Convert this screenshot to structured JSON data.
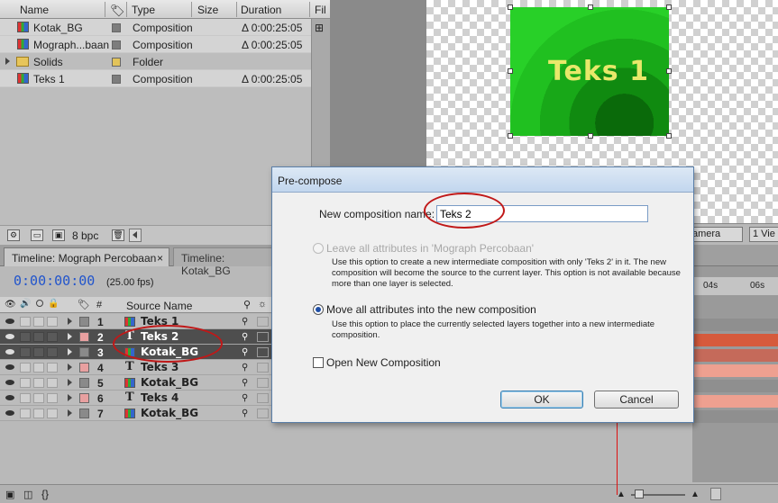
{
  "project": {
    "columns": {
      "name": "Name",
      "type": "Type",
      "size": "Size",
      "duration": "Duration",
      "fi": "Fil"
    },
    "items": [
      {
        "name": "Kotak_BG",
        "type": "Composition",
        "duration": "Δ 0:00:25:05",
        "icon": "composition-icon",
        "label_color": "#7d7d7d"
      },
      {
        "name": "Mograph...baan",
        "type": "Composition",
        "duration": "Δ 0:00:25:05",
        "icon": "composition-icon",
        "label_color": "#7d7d7d"
      },
      {
        "name": "Solids",
        "type": "Folder",
        "duration": "",
        "icon": "folder-icon",
        "label_color": "#e2c35a"
      },
      {
        "name": "Teks 1",
        "type": "Composition",
        "duration": "Δ 0:00:25:05",
        "icon": "composition-icon",
        "label_color": "#7d7d7d"
      }
    ],
    "bpc": "8 bpc"
  },
  "viewer": {
    "comp_text": "Teks 1",
    "camera": "amera",
    "view": "1 Vie"
  },
  "timeline": {
    "tabs": [
      "Timeline: Mograph Percobaan",
      "Timeline: Kotak_BG"
    ],
    "timecode": "0:00:00:00",
    "fps": "(25.00 fps)",
    "column_hash": "#",
    "column_source": "Source Name",
    "ruler": [
      "04s",
      "06s"
    ],
    "layers": [
      {
        "num": "1",
        "name": "Teks 1",
        "type": "composition",
        "color": "#8a8a8a",
        "selected": false
      },
      {
        "num": "2",
        "name": "Teks 2",
        "type": "text",
        "color": "#e8a0a0",
        "selected": true
      },
      {
        "num": "3",
        "name": "Kotak_BG",
        "type": "composition",
        "color": "#8a8a8a",
        "selected": true
      },
      {
        "num": "4",
        "name": "Teks 3",
        "type": "text",
        "color": "#e8a0a0",
        "selected": false
      },
      {
        "num": "5",
        "name": "Kotak_BG",
        "type": "composition",
        "color": "#8a8a8a",
        "selected": false
      },
      {
        "num": "6",
        "name": "Teks 4",
        "type": "text",
        "color": "#e8a0a0",
        "selected": false
      },
      {
        "num": "7",
        "name": "Kotak_BG",
        "type": "composition",
        "color": "#8a8a8a",
        "selected": false
      }
    ]
  },
  "dialog": {
    "title": "Pre-compose",
    "name_label": "New composition name:",
    "name_value": "Teks 2",
    "option1_label": "Leave all attributes in 'Mograph Percobaan'",
    "option1_desc": "Use this option to create a new intermediate composition with only 'Teks 2' in it.  The new composition will become the source to the current layer.  This option is not available because more than one layer is selected.",
    "option2_label": "Move all attributes into the new composition",
    "option2_desc": "Use this option to place the currently selected layers together into a new intermediate composition.",
    "checkbox_label": "Open New Composition",
    "ok": "OK",
    "cancel": "Cancel"
  },
  "colors": {
    "accent_red": "#c01818",
    "timecode_blue": "#2255cc",
    "track_red": "#d65a3c",
    "track_pink": "#eea090"
  }
}
